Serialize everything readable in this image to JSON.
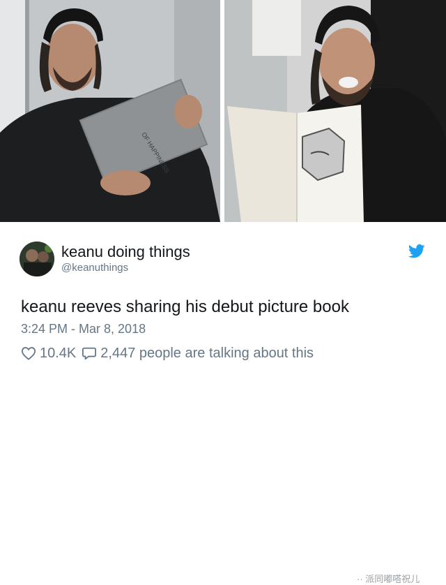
{
  "tweet": {
    "display_name": "keanu doing things",
    "handle": "@keanuthings",
    "text": "keanu reeves sharing his debut picture book",
    "timestamp": "3:24 PM - Mar 8, 2018",
    "likes": "10.4K",
    "replies": "2,447 people are talking about this"
  },
  "book_cover_text": "OF HAPPINESS",
  "watermark": "·· 派同嘟嗒祝儿",
  "colors": {
    "twitter_blue": "#1da1f2",
    "meta_gray": "#657786"
  },
  "icons": {
    "like": "heart-icon",
    "reply": "speech-bubble-icon",
    "brand": "twitter-bird-icon"
  }
}
